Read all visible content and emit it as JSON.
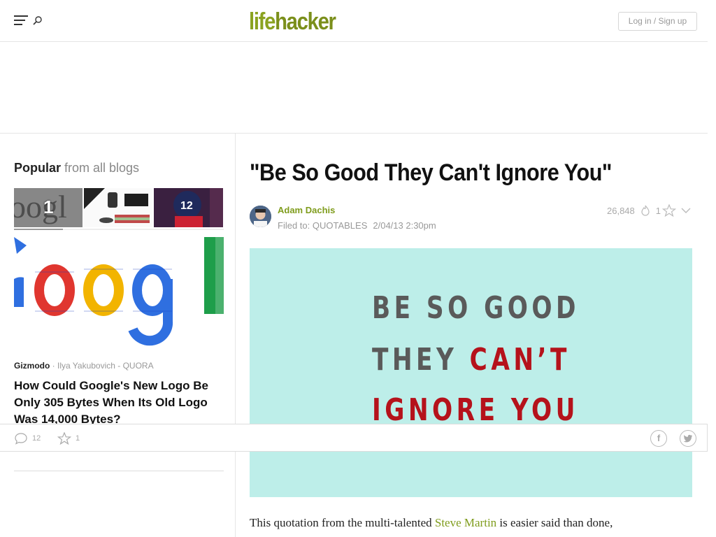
{
  "header": {
    "logo_part1": "life",
    "logo_part2": "hacker",
    "login_label": "Log in / Sign up"
  },
  "sidebar": {
    "popular_bold": "Popular",
    "popular_light": " from all blogs",
    "active_thumb_number": "1",
    "featured": {
      "blog": "Gizmodo",
      "author_source": " · Ilya Yakubovich - QUORA",
      "title": "How Could Google's New Logo Be Only 305 Bytes When Its Old Logo Was 14,000 Bytes?"
    }
  },
  "sharebar": {
    "comments_count": "12",
    "likes_count": "1"
  },
  "article": {
    "title": "\"Be So Good They Can't Ignore You\"",
    "author": "Adam Dachis",
    "filed_label": "Filed to: ",
    "filed_tag": "QUOTABLES",
    "date": "2/04/13 2:30pm",
    "views": "26,848",
    "likes": "1",
    "hero": {
      "line1": "BE SO GOOD",
      "line2_a": "THEY ",
      "line2_b": "CAN’T",
      "line3": "IGNORE YOU"
    },
    "body_before": "This quotation from the multi-talented ",
    "body_link": "Steve Martin",
    "body_after": " is easier said than done,"
  },
  "colors": {
    "brand_green": "#8aa220",
    "hero_bg": "#bdeee9",
    "hero_red": "#b5121b"
  }
}
